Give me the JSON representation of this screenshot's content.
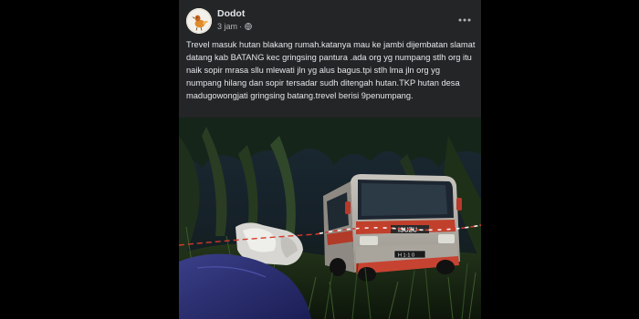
{
  "post": {
    "author": "Dodot",
    "time": "3 jam",
    "time_separator": "·",
    "privacy_icon": "globe-icon",
    "more_icon": "more-options-icon",
    "text": "Trevel masuk hutan blakang rumah.katanya mau ke jambi dijembatan slamat datang kab BATANG kec gringsing pantura .ada org yg numpang stlh org itu naik sopir mrasa sllu mlewati jln yg alus bagus.tpi stlh lma jln org yg numpang hilang dan sopir tersadar sudh ditengah hutan.TKP hutan desa madugowongjati gringsing batang.trevel berisi 9penumpang.",
    "photo": {
      "vehicle_brand": "ISUZU",
      "license_plate": "H 1·1 0"
    }
  },
  "colors": {
    "page_background": "#000000",
    "card_background": "#242526",
    "primary_text": "#e4e6eb",
    "secondary_text": "#b0b3b8"
  }
}
